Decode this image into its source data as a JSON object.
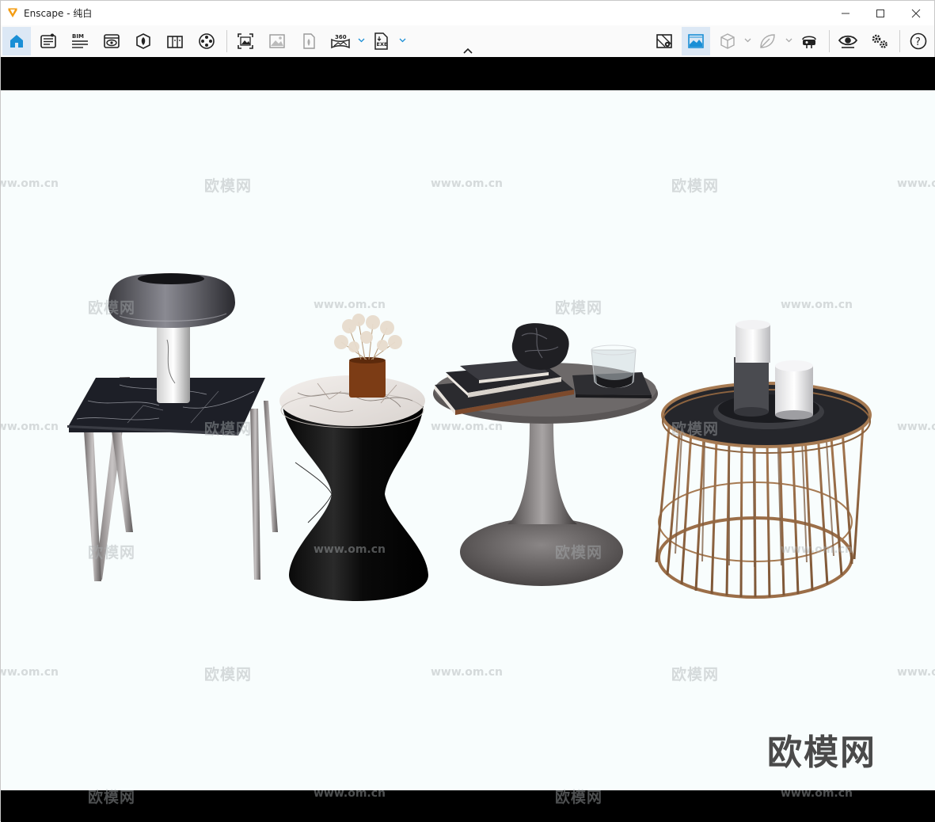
{
  "window": {
    "title": "Enscape - 纯白"
  },
  "toolbar": {
    "left_buttons": [
      {
        "name": "home-icon",
        "active": true
      },
      {
        "name": "views-list-icon"
      },
      {
        "name": "bim-icon",
        "label": "BIM"
      },
      {
        "name": "visibility-panel-icon"
      },
      {
        "name": "asset-library-icon"
      },
      {
        "name": "material-editor-icon"
      },
      {
        "name": "video-editor-icon"
      },
      {
        "name": "screenshot-icon"
      },
      {
        "name": "batch-render-icon"
      },
      {
        "name": "web-standalone-icon"
      },
      {
        "name": "panorama-360-icon",
        "label": "360"
      },
      {
        "name": "export-exe-icon",
        "label": "EXE"
      }
    ],
    "right_buttons": [
      {
        "name": "map-icon"
      },
      {
        "name": "capture-view-icon"
      },
      {
        "name": "cube-icon"
      },
      {
        "name": "leaf-icon"
      },
      {
        "name": "vr-headset-icon"
      },
      {
        "name": "eye-icon"
      },
      {
        "name": "settings-gears-icon"
      },
      {
        "name": "help-icon",
        "label": "?"
      }
    ]
  },
  "watermark": {
    "brand": "欧模网",
    "url": "www.om.cn",
    "big": "欧模网"
  },
  "colors": {
    "accent": "#1a8fd6",
    "logo": "#f39c12",
    "letterbox": "#000000",
    "viewport_bg": "#f8fdfd"
  }
}
